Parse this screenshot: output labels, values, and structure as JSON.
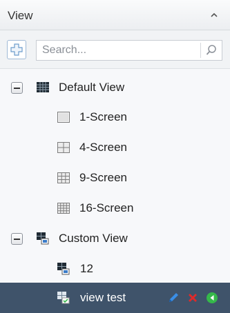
{
  "header": {
    "title": "View",
    "collapse_icon": "chevron-up-icon"
  },
  "search": {
    "placeholder": "Search..."
  },
  "tree": {
    "groups": [
      {
        "label": "Default View",
        "expanded": true,
        "items": [
          {
            "label": "1-Screen",
            "icon": "layout-1-icon"
          },
          {
            "label": "4-Screen",
            "icon": "layout-4-icon"
          },
          {
            "label": "9-Screen",
            "icon": "layout-9-icon"
          },
          {
            "label": "16-Screen",
            "icon": "layout-16-icon"
          }
        ]
      },
      {
        "label": "Custom View",
        "expanded": true,
        "items": [
          {
            "label": "12",
            "icon": "custom-view-icon"
          },
          {
            "label": "view test",
            "icon": "custom-view-icon",
            "selected": true
          }
        ]
      }
    ]
  },
  "colors": {
    "selected_row_bg": "#3f536a",
    "edit_icon": "#3a8ee6",
    "delete_icon": "#e02a2a",
    "play_icon": "#35b84a"
  }
}
